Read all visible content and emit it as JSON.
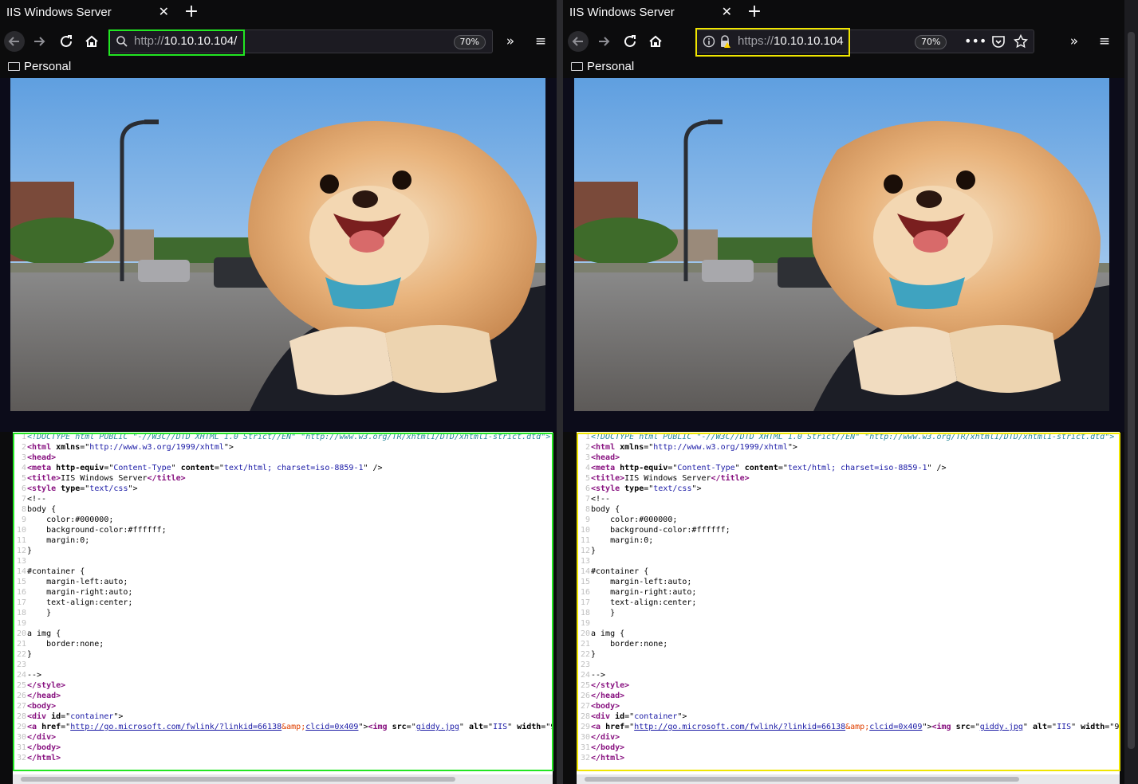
{
  "colors": {
    "left_highlight": "#22e622",
    "right_highlight": "#f0e600"
  },
  "panes": [
    {
      "tab_title": "IIS Windows Server",
      "url_protocol": "http://",
      "url_host": "10.10.10.104/",
      "zoom": "70%",
      "bookmark": "Personal",
      "highlight": "green"
    },
    {
      "tab_title": "IIS Windows Server",
      "url_protocol": "https://",
      "url_host": "10.10.10.104",
      "zoom": "70%",
      "bookmark": "Personal",
      "highlight": "yellow"
    }
  ],
  "icons": [
    "back-icon",
    "forward-icon",
    "reload-icon",
    "home-icon",
    "search-icon",
    "info-icon",
    "insecure-lock-icon",
    "overflow-icon",
    "hamburger-menu-icon",
    "page-actions-icon",
    "pocket-icon",
    "bookmark-star-icon",
    "folder-icon",
    "close-icon",
    "new-tab-icon"
  ],
  "source_lines": [
    [
      [
        "c-comment",
        "<!DOCTYPE html PUBLIC \"-//W3C//DTD XHTML 1.0 Strict//EN\" \"http://www.w3.org/TR/xhtml1/DTD/xhtml1-strict.dtd\">"
      ]
    ],
    [
      [
        "c-tag",
        "<html "
      ],
      [
        "c-attr",
        "xmlns"
      ],
      [
        "",
        "=\""
      ],
      [
        "c-val",
        "http://www.w3.org/1999/xhtml"
      ],
      [
        "",
        "\">"
      ]
    ],
    [
      [
        "c-tag",
        "<head>"
      ]
    ],
    [
      [
        "c-tag",
        "<meta "
      ],
      [
        "c-attr",
        "http-equiv"
      ],
      [
        "",
        "=\""
      ],
      [
        "c-val",
        "Content-Type"
      ],
      [
        "",
        "\" "
      ],
      [
        "c-attr",
        "content"
      ],
      [
        "",
        "=\""
      ],
      [
        "c-val",
        "text/html; charset=iso-8859-1"
      ],
      [
        "",
        "\" />"
      ]
    ],
    [
      [
        "c-tag",
        "<title>"
      ],
      [
        "",
        "IIS Windows Server"
      ],
      [
        "c-tag",
        "</title>"
      ]
    ],
    [
      [
        "c-tag",
        "<style "
      ],
      [
        "c-attr",
        "type"
      ],
      [
        "",
        "=\""
      ],
      [
        "c-val",
        "text/css"
      ],
      [
        "",
        "\">"
      ]
    ],
    [
      [
        "",
        "<!--"
      ]
    ],
    [
      [
        "",
        "body {"
      ]
    ],
    [
      [
        "",
        "    color:#000000;"
      ]
    ],
    [
      [
        "",
        "    background-color:#ffffff;"
      ]
    ],
    [
      [
        "",
        "    margin:0;"
      ]
    ],
    [
      [
        "",
        "}"
      ]
    ],
    [
      [
        "",
        ""
      ]
    ],
    [
      [
        "",
        "#container {"
      ]
    ],
    [
      [
        "",
        "    margin-left:auto;"
      ]
    ],
    [
      [
        "",
        "    margin-right:auto;"
      ]
    ],
    [
      [
        "",
        "    text-align:center;"
      ]
    ],
    [
      [
        "",
        "    }"
      ]
    ],
    [
      [
        "",
        ""
      ]
    ],
    [
      [
        "",
        "a img {"
      ]
    ],
    [
      [
        "",
        "    border:none;"
      ]
    ],
    [
      [
        "",
        "}"
      ]
    ],
    [
      [
        "",
        ""
      ]
    ],
    [
      [
        "",
        "-->"
      ]
    ],
    [
      [
        "c-tag",
        "</style>"
      ]
    ],
    [
      [
        "c-tag",
        "</head>"
      ]
    ],
    [
      [
        "c-tag",
        "<body>"
      ]
    ],
    [
      [
        "c-tag",
        "<div "
      ],
      [
        "c-attr",
        "id"
      ],
      [
        "",
        "=\""
      ],
      [
        "c-val",
        "container"
      ],
      [
        "",
        "\">"
      ]
    ],
    [
      [
        "c-tag",
        "<a "
      ],
      [
        "c-attr",
        "href"
      ],
      [
        "",
        "=\""
      ],
      [
        "c-link",
        "http://go.microsoft.com/fwlink/?linkid=66138"
      ],
      [
        "c-ent",
        "&amp;"
      ],
      [
        "c-link",
        "clcid=0x409"
      ],
      [
        "",
        "\">"
      ],
      [
        "c-tag",
        "<img "
      ],
      [
        "c-attr",
        "src"
      ],
      [
        "",
        "=\""
      ],
      [
        "c-link",
        "giddy.jpg"
      ],
      [
        "",
        "\" "
      ],
      [
        "c-attr",
        "alt"
      ],
      [
        "",
        "=\""
      ],
      [
        "c-val",
        "IIS"
      ],
      [
        "",
        "\" "
      ],
      [
        "c-attr",
        "width"
      ],
      [
        "",
        "=\"9"
      ]
    ],
    [
      [
        "c-tag",
        "</div>"
      ]
    ],
    [
      [
        "c-tag",
        "</body>"
      ]
    ],
    [
      [
        "c-tag",
        "</html>"
      ]
    ]
  ]
}
